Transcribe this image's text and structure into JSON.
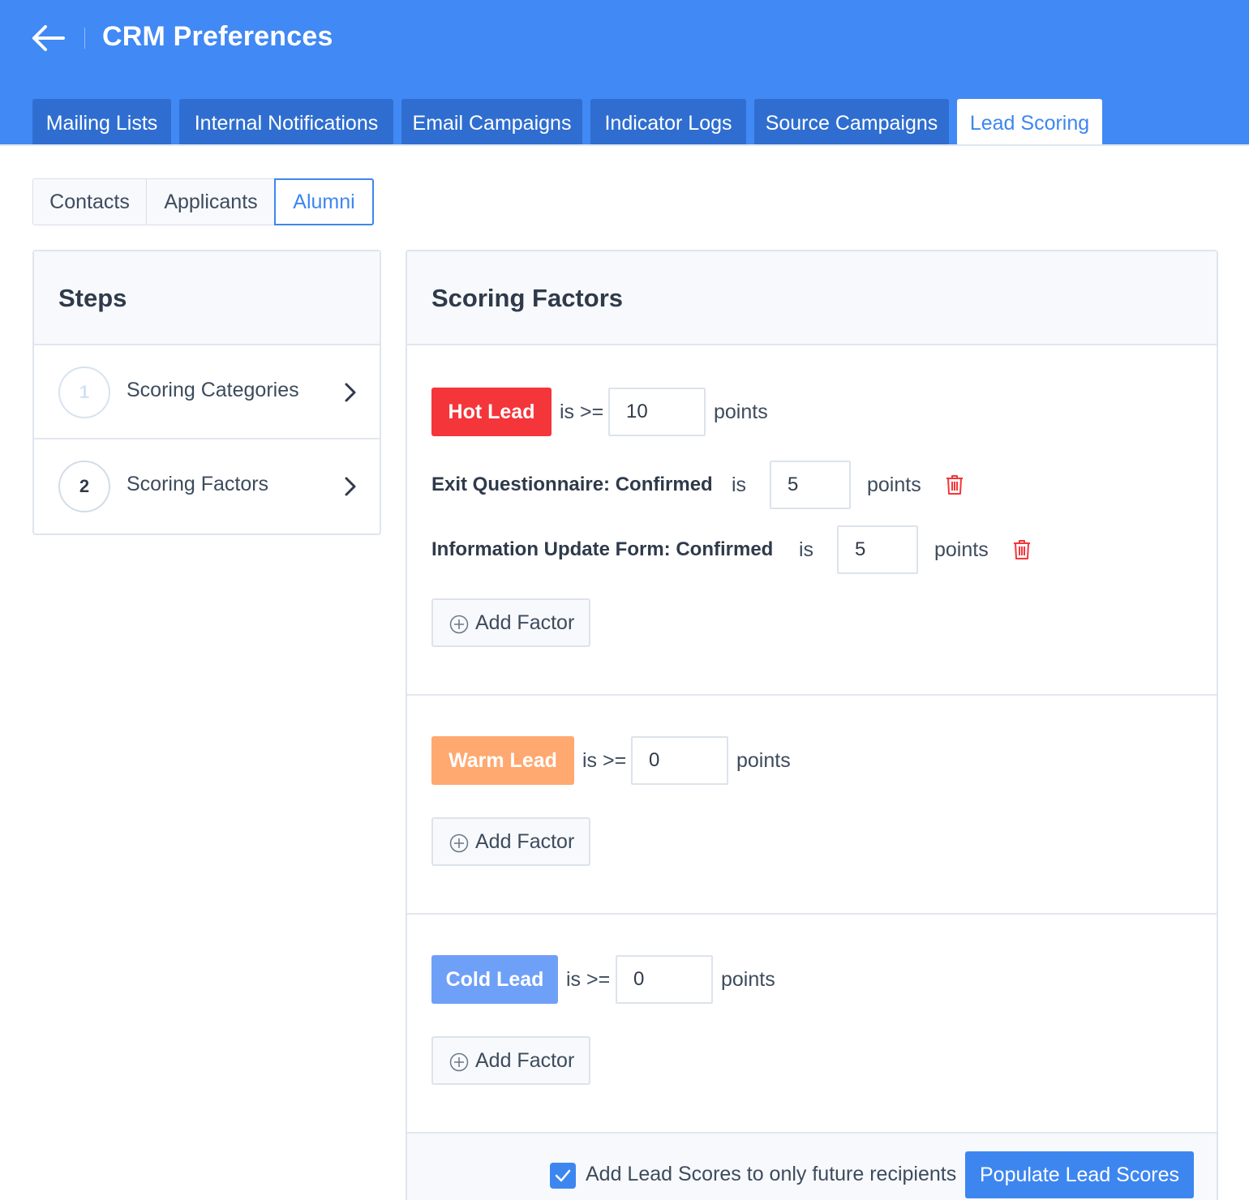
{
  "app": {
    "title": "CRM Preferences"
  },
  "tabs": [
    {
      "label": "Mailing Lists"
    },
    {
      "label": "Internal Notifications"
    },
    {
      "label": "Email Campaigns"
    },
    {
      "label": "Indicator Logs"
    },
    {
      "label": "Source Campaigns"
    },
    {
      "label": "Lead Scoring",
      "active": true
    }
  ],
  "segments": [
    {
      "label": "Contacts"
    },
    {
      "label": "Applicants"
    },
    {
      "label": "Alumni",
      "active": true
    }
  ],
  "steps": {
    "title": "Steps",
    "items": [
      {
        "number": "1",
        "label": "Scoring Categories"
      },
      {
        "number": "2",
        "label": "Scoring Factors"
      }
    ]
  },
  "scoring": {
    "title": "Scoring Factors",
    "categories": [
      {
        "name": "Hot Lead",
        "color": "#f4353a",
        "operator": "is >=",
        "threshold": "10",
        "unit": "points",
        "factors": [
          {
            "label": "Exit Questionnaire: Confirmed",
            "operator": "is",
            "value": "5",
            "unit": "points"
          },
          {
            "label": "Information Update Form: Confirmed",
            "operator": "is",
            "value": "5",
            "unit": "points"
          }
        ],
        "add_label": "Add Factor"
      },
      {
        "name": "Warm Lead",
        "color": "#ffa870",
        "operator": "is >=",
        "threshold": "0",
        "unit": "points",
        "factors": [],
        "add_label": "Add Factor"
      },
      {
        "name": "Cold Lead",
        "color": "#6fa0f7",
        "operator": "is >=",
        "threshold": "0",
        "unit": "points",
        "factors": [],
        "add_label": "Add Factor"
      }
    ]
  },
  "footer": {
    "checkbox_label": "Add Lead Scores to only future recipients",
    "checkbox_checked": true,
    "populate_label": "Populate Lead Scores"
  },
  "icons": {
    "back": "arrow-left-icon",
    "chevron": "chevron-right-icon",
    "trash": "trash-icon",
    "add": "plus-circle-icon",
    "check": "check-icon"
  }
}
